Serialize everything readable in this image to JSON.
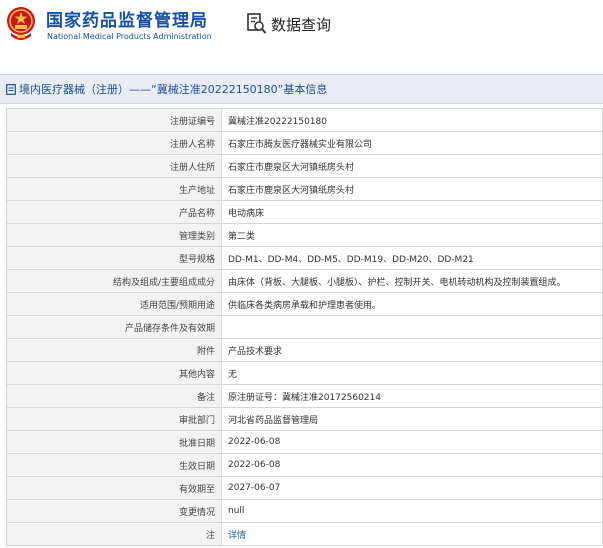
{
  "header": {
    "agency_cn": "国家药品监督管理局",
    "agency_en": "National Medical Products Administration",
    "query_label": "数据查询",
    "brand_color": "#1750a4"
  },
  "page": {
    "title": "境内医疗器械（注册）——“冀械注准20222150180”基本信息"
  },
  "rows": [
    {
      "label": "注册证编号",
      "value": "冀械注准20222150180"
    },
    {
      "label": "注册人名称",
      "value": "石家庄市腾友医疗器械实业有限公司"
    },
    {
      "label": "注册人住所",
      "value": "石家庄市鹿泉区大河镇纸房头村"
    },
    {
      "label": "生产地址",
      "value": "石家庄市鹿泉区大河镇纸房头村"
    },
    {
      "label": "产品名称",
      "value": "电动病床"
    },
    {
      "label": "管理类别",
      "value": "第二类"
    },
    {
      "label": "型号规格",
      "value": "DD-M1、DD-M4、DD-M5、DD-M19、DD-M20、DD-M21"
    },
    {
      "label": "结构及组成/主要组成成分",
      "value": "由床体（背板、大腿板、小腿板）、护栏、控制开关、电机转动机构及控制装置组成。"
    },
    {
      "label": "适用范围/预期用途",
      "value": "供临床各类病房承载和护理患者使用。"
    },
    {
      "label": "产品储存条件及有效期",
      "value": ""
    },
    {
      "label": "附件",
      "value": "产品技术要求"
    },
    {
      "label": "其他内容",
      "value": "无"
    },
    {
      "label": "备注",
      "value": "原注册证号：冀械注准20172560214"
    },
    {
      "label": "审批部门",
      "value": "河北省药品监督管理局"
    },
    {
      "label": "批准日期",
      "value": "2022-06-08"
    },
    {
      "label": "生效日期",
      "value": "2022-06-08"
    },
    {
      "label": "有效期至",
      "value": "2027-06-07"
    },
    {
      "label": "变更情况",
      "value": "null"
    },
    {
      "label": "注",
      "value": "详情"
    }
  ]
}
